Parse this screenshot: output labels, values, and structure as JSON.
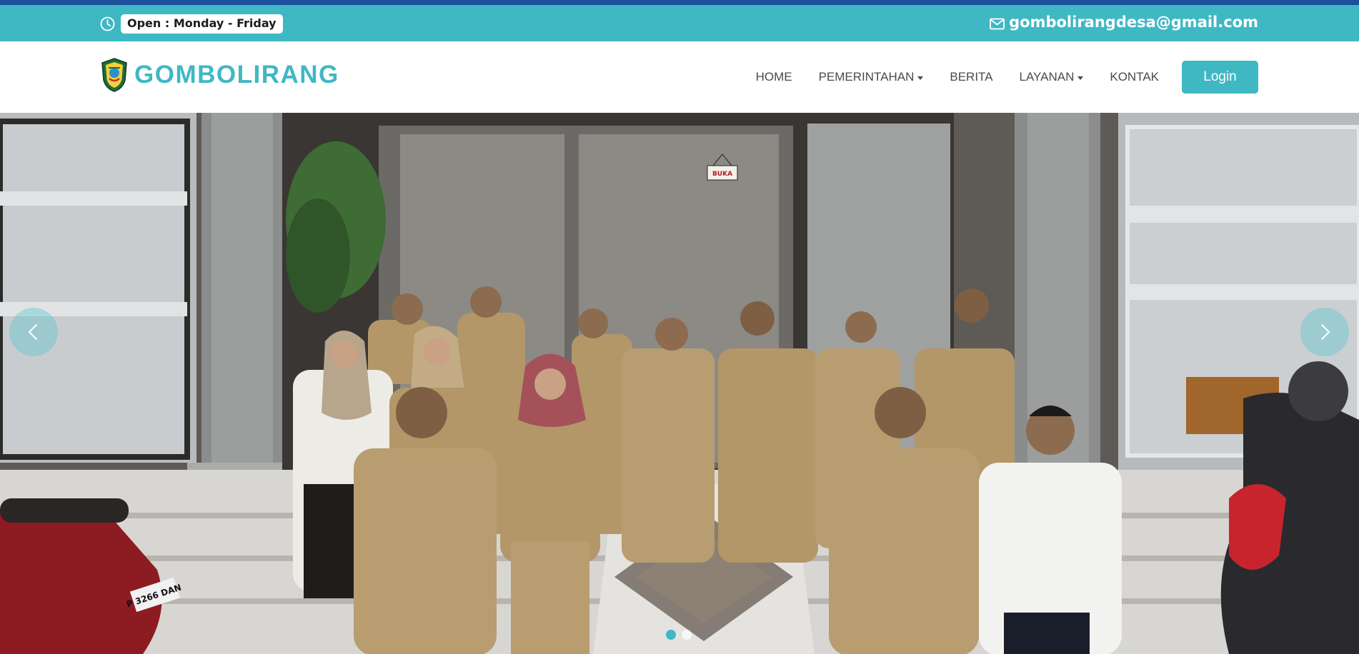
{
  "topbar": {
    "hours_text": "Open : Monday - Friday",
    "email": "gombolirangdesa@gmail.com",
    "icons": {
      "hours": "clock-icon",
      "email": "mail-icon"
    }
  },
  "brand": {
    "name": "GOMBOLIRANG",
    "logo": "village-emblem-logo"
  },
  "nav": {
    "items": [
      {
        "label": "HOME",
        "dropdown": false
      },
      {
        "label": "PEMERINTAHAN",
        "dropdown": true
      },
      {
        "label": "BERITA",
        "dropdown": false
      },
      {
        "label": "LAYANAN",
        "dropdown": true
      },
      {
        "label": "KONTAK",
        "dropdown": false
      }
    ],
    "login_label": "Login"
  },
  "hero": {
    "slide_count": 2,
    "active_slide": 1,
    "sign_text": "BUKA",
    "plate_left": "P 3266 DAN",
    "icons": {
      "prev": "chevron-left-icon",
      "next": "chevron-right-icon"
    }
  },
  "colors": {
    "accent": "#3fb8c4",
    "top_stripe": "#1d4f9c",
    "nav_text": "#4a4a4a",
    "uniform": "#b79c70"
  }
}
